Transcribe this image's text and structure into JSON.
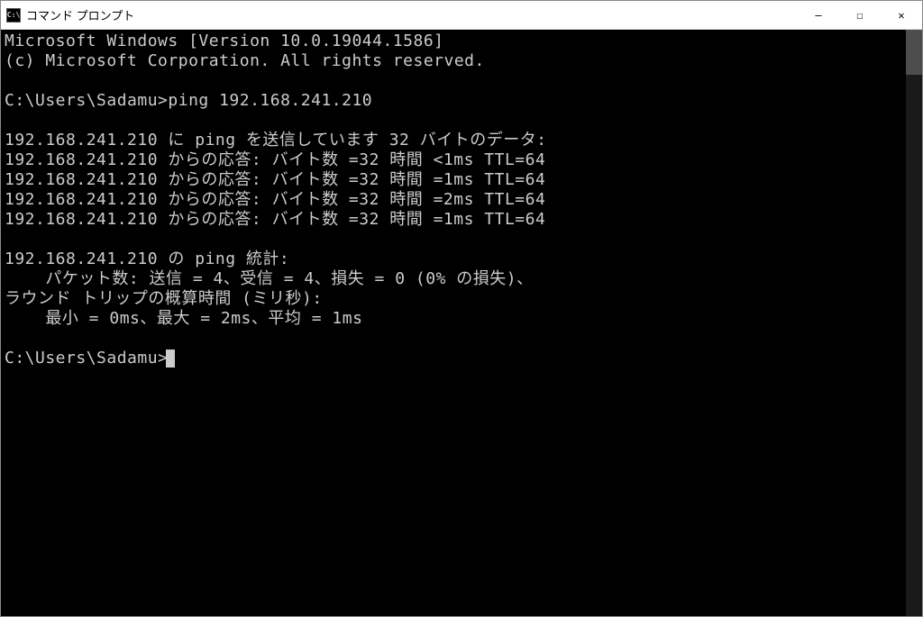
{
  "titlebar": {
    "icon_text": "C:\\",
    "title": "コマンド プロンプト"
  },
  "window_controls": {
    "minimize": "—",
    "maximize": "☐",
    "close": "✕"
  },
  "terminal": {
    "lines": [
      "Microsoft Windows [Version 10.0.19044.1586]",
      "(c) Microsoft Corporation. All rights reserved.",
      "",
      "C:\\Users\\Sadamu>ping 192.168.241.210",
      "",
      "192.168.241.210 に ping を送信しています 32 バイトのデータ:",
      "192.168.241.210 からの応答: バイト数 =32 時間 <1ms TTL=64",
      "192.168.241.210 からの応答: バイト数 =32 時間 =1ms TTL=64",
      "192.168.241.210 からの応答: バイト数 =32 時間 =2ms TTL=64",
      "192.168.241.210 からの応答: バイト数 =32 時間 =1ms TTL=64",
      "",
      "192.168.241.210 の ping 統計:",
      "    パケット数: 送信 = 4、受信 = 4、損失 = 0 (0% の損失)、",
      "ラウンド トリップの概算時間 (ミリ秒):",
      "    最小 = 0ms、最大 = 2ms、平均 = 1ms",
      "",
      "C:\\Users\\Sadamu>"
    ]
  }
}
